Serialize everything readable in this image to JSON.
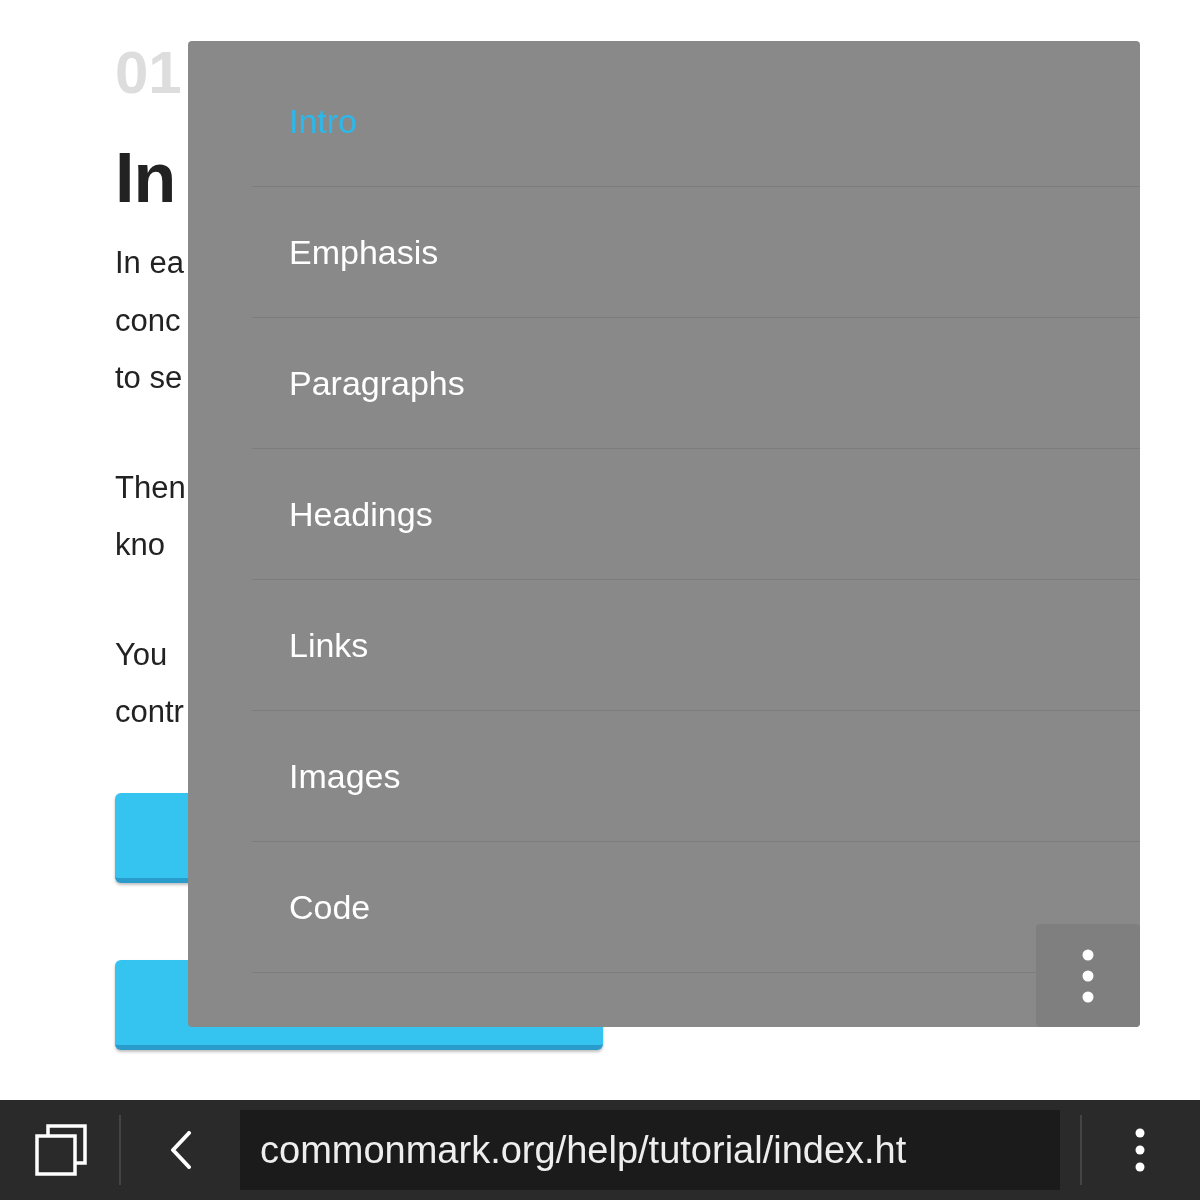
{
  "page": {
    "section_number": "01",
    "heading": "In",
    "paragraphs": [
      {
        "lines": [
          "In ea",
          "conc",
          "to se"
        ]
      },
      {
        "lines": [
          "Then",
          "kno"
        ]
      },
      {
        "lines": [
          "You",
          "contr"
        ]
      }
    ]
  },
  "menu": {
    "items": [
      {
        "label": "Intro",
        "selected": true
      },
      {
        "label": "Emphasis",
        "selected": false
      },
      {
        "label": "Paragraphs",
        "selected": false
      },
      {
        "label": "Headings",
        "selected": false
      },
      {
        "label": "Links",
        "selected": false
      },
      {
        "label": "Images",
        "selected": false
      },
      {
        "label": "Code",
        "selected": false
      }
    ]
  },
  "browser_bar": {
    "url": "commonmark.org/help/tutorial/index.ht"
  }
}
